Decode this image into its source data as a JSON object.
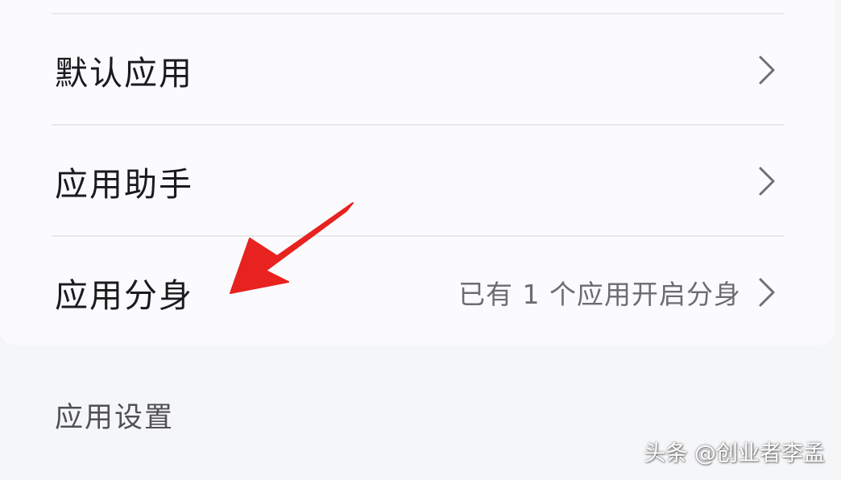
{
  "settings": {
    "items": [
      {
        "label": "默认应用",
        "value": ""
      },
      {
        "label": "应用助手",
        "value": ""
      },
      {
        "label": "应用分身",
        "value": "已有 1 个应用开启分身"
      }
    ],
    "section_header": "应用设置"
  },
  "annotation": {
    "arrow_color": "#e8221f",
    "arrow_points_to": "应用分身"
  },
  "watermark": "头条 @创业者李孟",
  "icons": {
    "chevron": "chevron-right-icon",
    "annotation": "red-arrow-icon"
  }
}
